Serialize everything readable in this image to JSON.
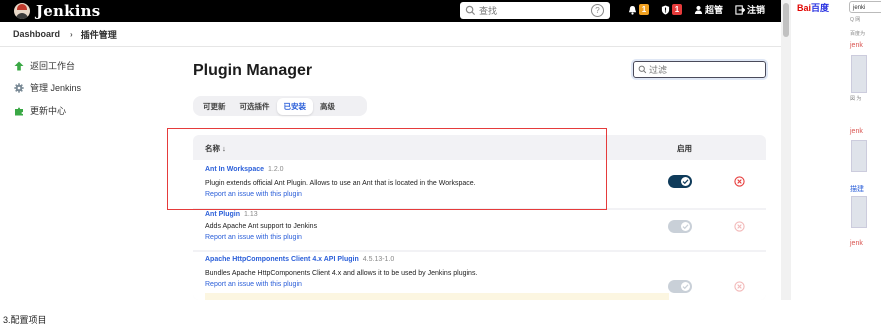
{
  "header": {
    "logo_text": "Jenkins",
    "search_placeholder": "查找",
    "help_glyph": "?",
    "notifications_count": "1",
    "security_count": "1",
    "user_name": "超管",
    "logout_label": "注销"
  },
  "breadcrumb": {
    "items": [
      "Dashboard",
      "插件管理"
    ],
    "separator": "›"
  },
  "sidebar": {
    "items": [
      {
        "label": "返回工作台",
        "icon": "arrow-up-icon"
      },
      {
        "label": "管理 Jenkins",
        "icon": "gear-icon"
      },
      {
        "label": "更新中心",
        "icon": "puzzle-icon"
      }
    ]
  },
  "main": {
    "title": "Plugin Manager",
    "filter_placeholder": "过滤",
    "tabs": [
      {
        "label": "可更新",
        "active": false
      },
      {
        "label": "可选插件",
        "active": false
      },
      {
        "label": "已安装",
        "active": true
      },
      {
        "label": "高级",
        "active": false
      }
    ],
    "table": {
      "col_name": "名称 ↓",
      "col_enabled": "启用",
      "rows": [
        {
          "name": "Ant In Workspace",
          "version": "1.2.0",
          "description": "Plugin extends official Ant Plugin. Allows to use an Ant that is located in the Workspace.",
          "link": "Report an issue with this plugin",
          "enabled": true
        },
        {
          "name": "Ant Plugin",
          "version": "1.13",
          "description": "Adds Apache Ant support to Jenkins",
          "link": "Report an issue with this plugin",
          "enabled": false
        },
        {
          "name": "Apache HttpComponents Client 4.x API Plugin",
          "version": "4.5.13-1.0",
          "description": "Bundles Apache HttpComponents Client 4.x and allows it to be used by Jenkins plugins.",
          "link": "Report an issue with this plugin",
          "enabled": false
        }
      ]
    }
  },
  "side_panel": {
    "logo": "Bai",
    "logo_b": "百度",
    "input_value": "jenki",
    "small_1": "Q 网",
    "small_2": "百度为",
    "link_1": "jenk",
    "small_3": "図 为",
    "link_2": "jenk",
    "link_3": "描建",
    "link_4": "jenk"
  },
  "caption": "3.配置项目",
  "colors": {
    "accent": "#2b5fd9",
    "highlight": "#e53b3b",
    "toggle_on": "#0f3b5a",
    "danger": "#e63b3b"
  }
}
